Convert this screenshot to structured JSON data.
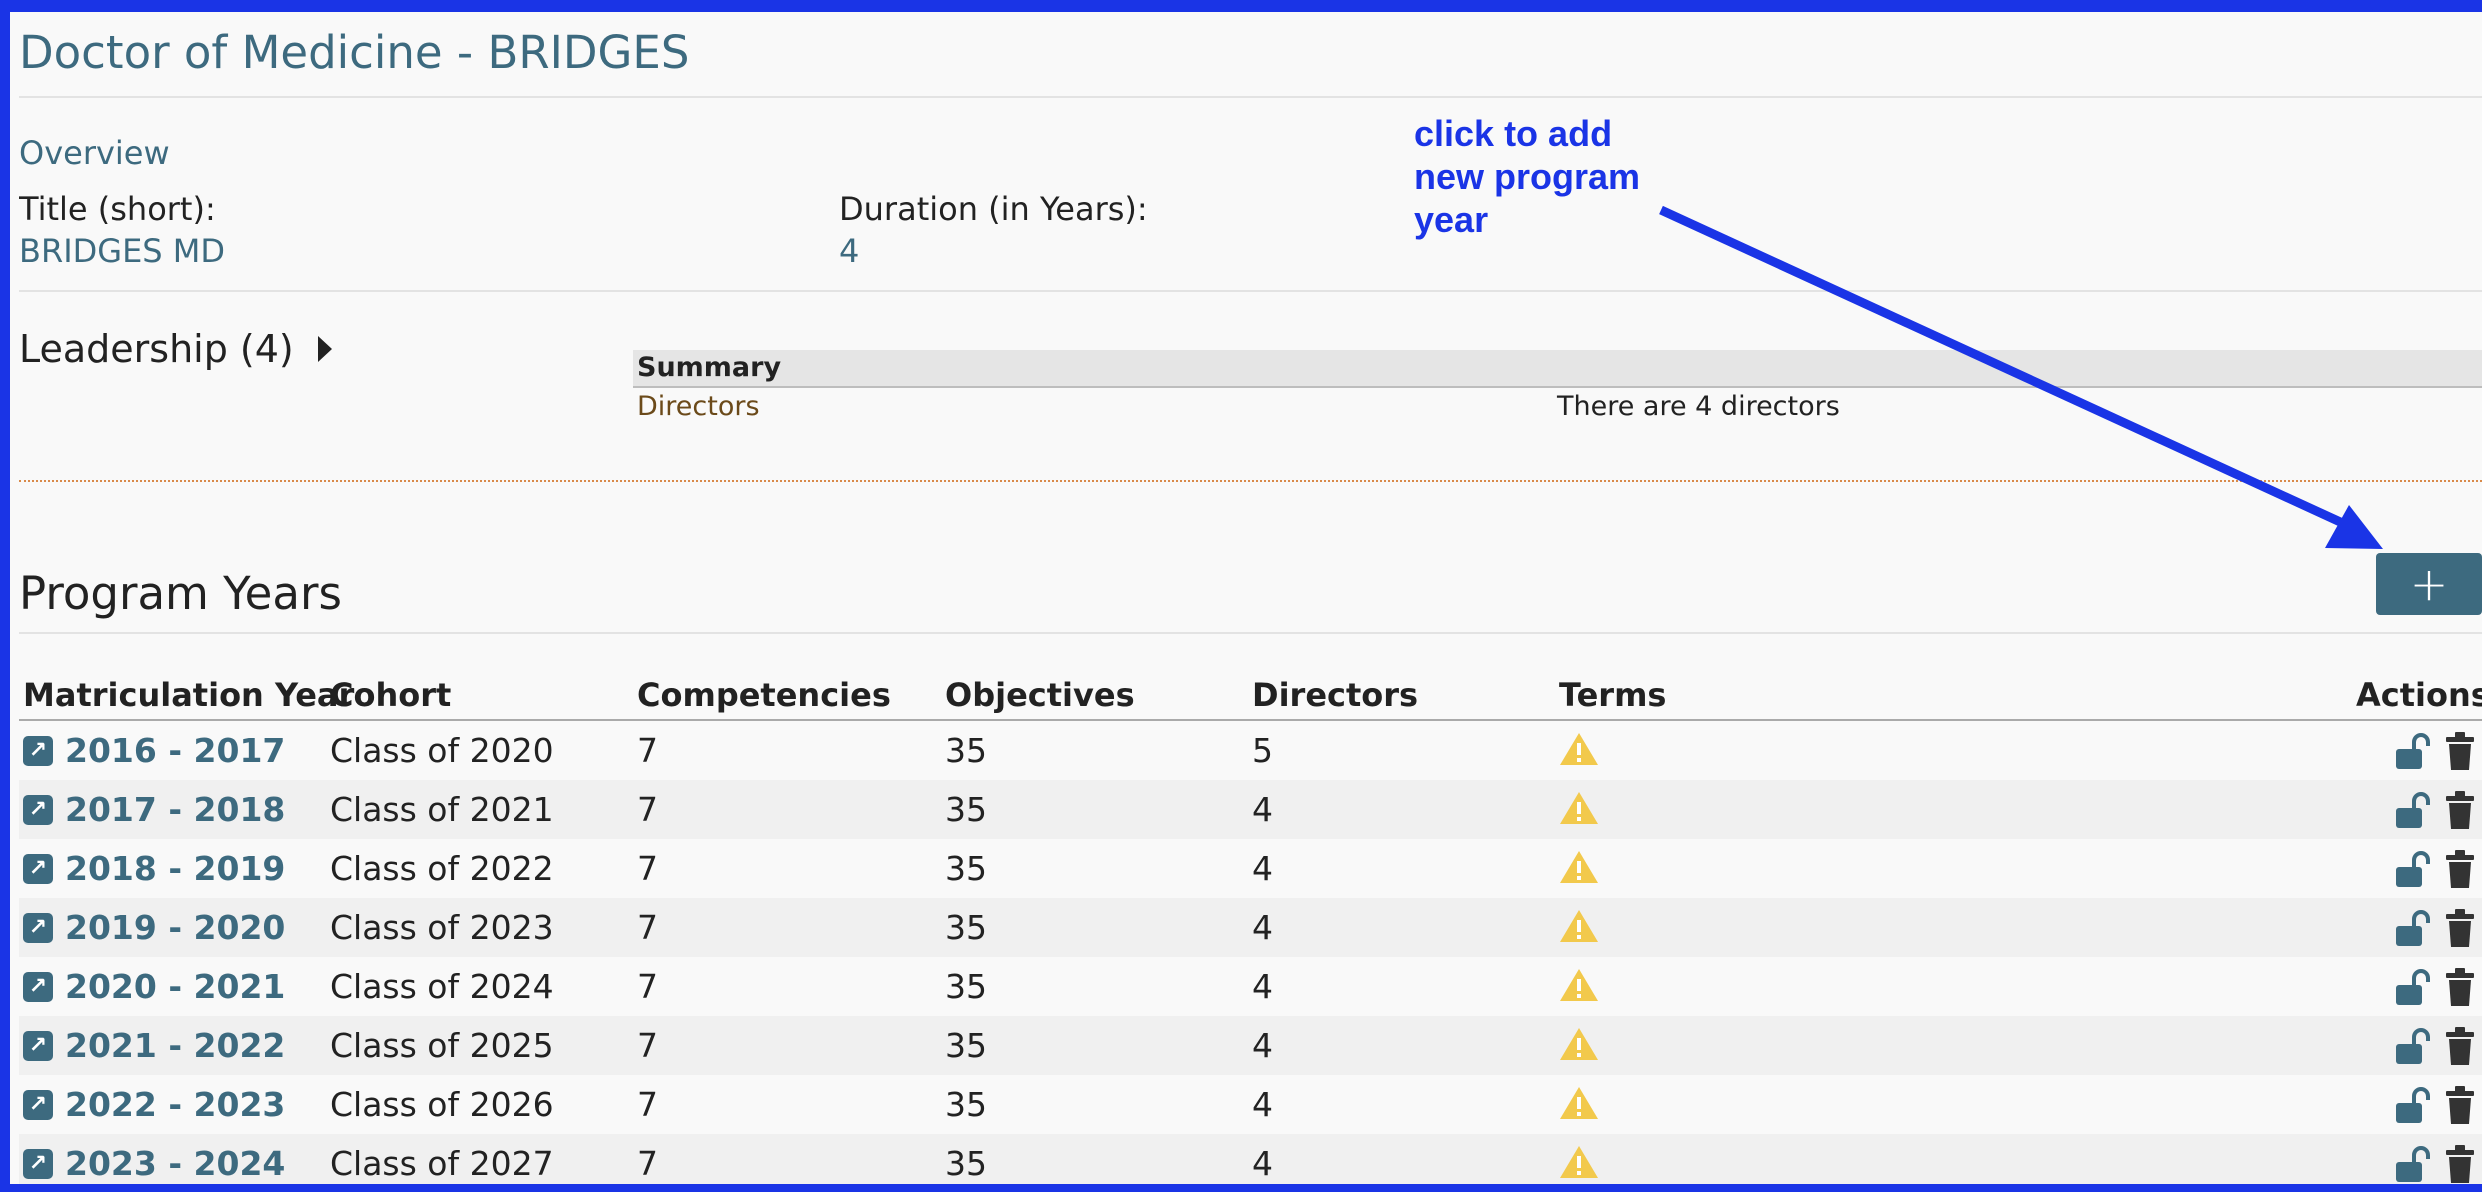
{
  "page": {
    "title": "Doctor of Medicine - BRIDGES"
  },
  "overview": {
    "link_label": "Overview",
    "title_short_label": "Title (short):",
    "title_short_value": "BRIDGES MD",
    "duration_label": "Duration (in Years):",
    "duration_value": "4"
  },
  "annotation": {
    "line1": "click to add",
    "line2": "new program",
    "line3": "year",
    "color": "#1a34e6"
  },
  "leadership": {
    "title": "Leadership (4)",
    "summary_header": "Summary",
    "row_label": "Directors",
    "row_value": "There are 4 directors"
  },
  "program_years": {
    "title": "Program Years",
    "add_button_label": "+",
    "columns": [
      "Matriculation Year",
      "Cohort",
      "Competencies",
      "Objectives",
      "Directors",
      "Terms",
      "Actions"
    ],
    "rows": [
      {
        "year": "2016 - 2017",
        "cohort": "Class of 2020",
        "competencies": "7",
        "objectives": "35",
        "directors": "5"
      },
      {
        "year": "2017 - 2018",
        "cohort": "Class of 2021",
        "competencies": "7",
        "objectives": "35",
        "directors": "4"
      },
      {
        "year": "2018 - 2019",
        "cohort": "Class of 2022",
        "competencies": "7",
        "objectives": "35",
        "directors": "4"
      },
      {
        "year": "2019 - 2020",
        "cohort": "Class of 2023",
        "competencies": "7",
        "objectives": "35",
        "directors": "4"
      },
      {
        "year": "2020 - 2021",
        "cohort": "Class of 2024",
        "competencies": "7",
        "objectives": "35",
        "directors": "4"
      },
      {
        "year": "2021 - 2022",
        "cohort": "Class of 2025",
        "competencies": "7",
        "objectives": "35",
        "directors": "4"
      },
      {
        "year": "2022 - 2023",
        "cohort": "Class of 2026",
        "competencies": "7",
        "objectives": "35",
        "directors": "4"
      },
      {
        "year": "2023 - 2024",
        "cohort": "Class of 2027",
        "competencies": "7",
        "objectives": "35",
        "directors": "4"
      }
    ],
    "icons": {
      "year_link": "external-link-icon",
      "terms": "warning-icon",
      "unlock": "unlock-icon",
      "delete": "trash-icon"
    }
  },
  "colors": {
    "accent": "#3d6a7f",
    "warning": "#f2c94c",
    "annotation": "#1a34e6"
  }
}
